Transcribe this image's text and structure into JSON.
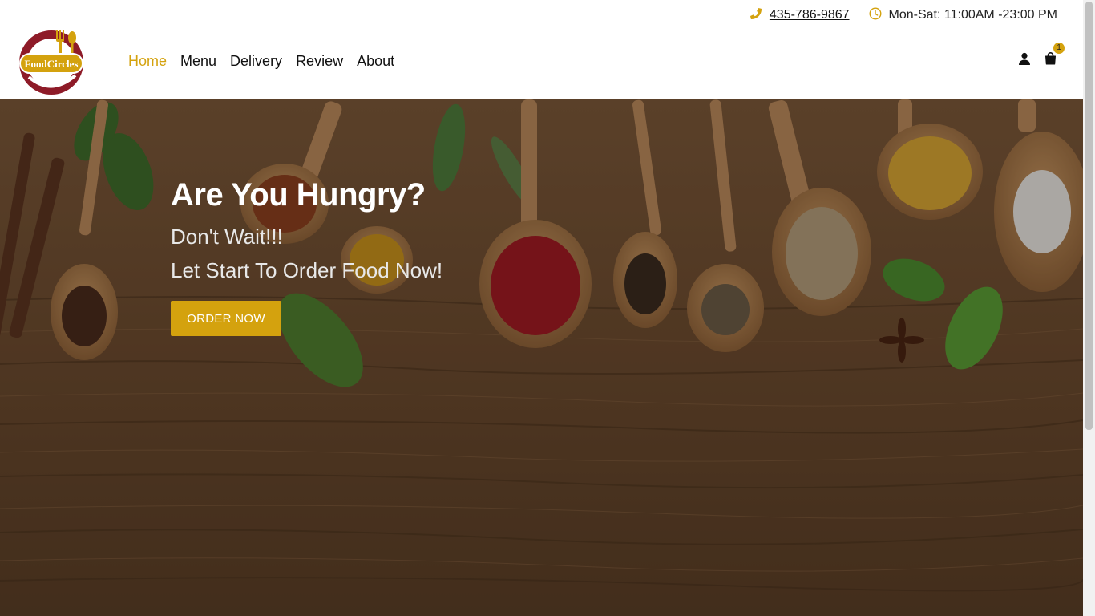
{
  "topbar": {
    "phone": "435-786-9867",
    "hours": "Mon-Sat: 11:00AM -23:00 PM",
    "phone_icon": "phone-icon",
    "clock_icon": "clock-icon"
  },
  "brand": {
    "logo_text": "FoodCircles"
  },
  "nav": {
    "items": [
      {
        "label": "Home",
        "active": true
      },
      {
        "label": "Menu"
      },
      {
        "label": "Delivery"
      },
      {
        "label": "Review"
      },
      {
        "label": "About"
      }
    ]
  },
  "header_icons": {
    "user_icon": "user-icon",
    "cart_icon": "shopping-bag-icon",
    "cart_count": "1"
  },
  "hero": {
    "title": "Are You Hungry?",
    "line1": "Don't Wait!!!",
    "line2": "Let Start To Order Food Now!",
    "button": "ORDER NOW"
  },
  "colors": {
    "accent": "#d4a20e",
    "logo_red": "#8e1b28",
    "wood": "#5a3e26"
  }
}
